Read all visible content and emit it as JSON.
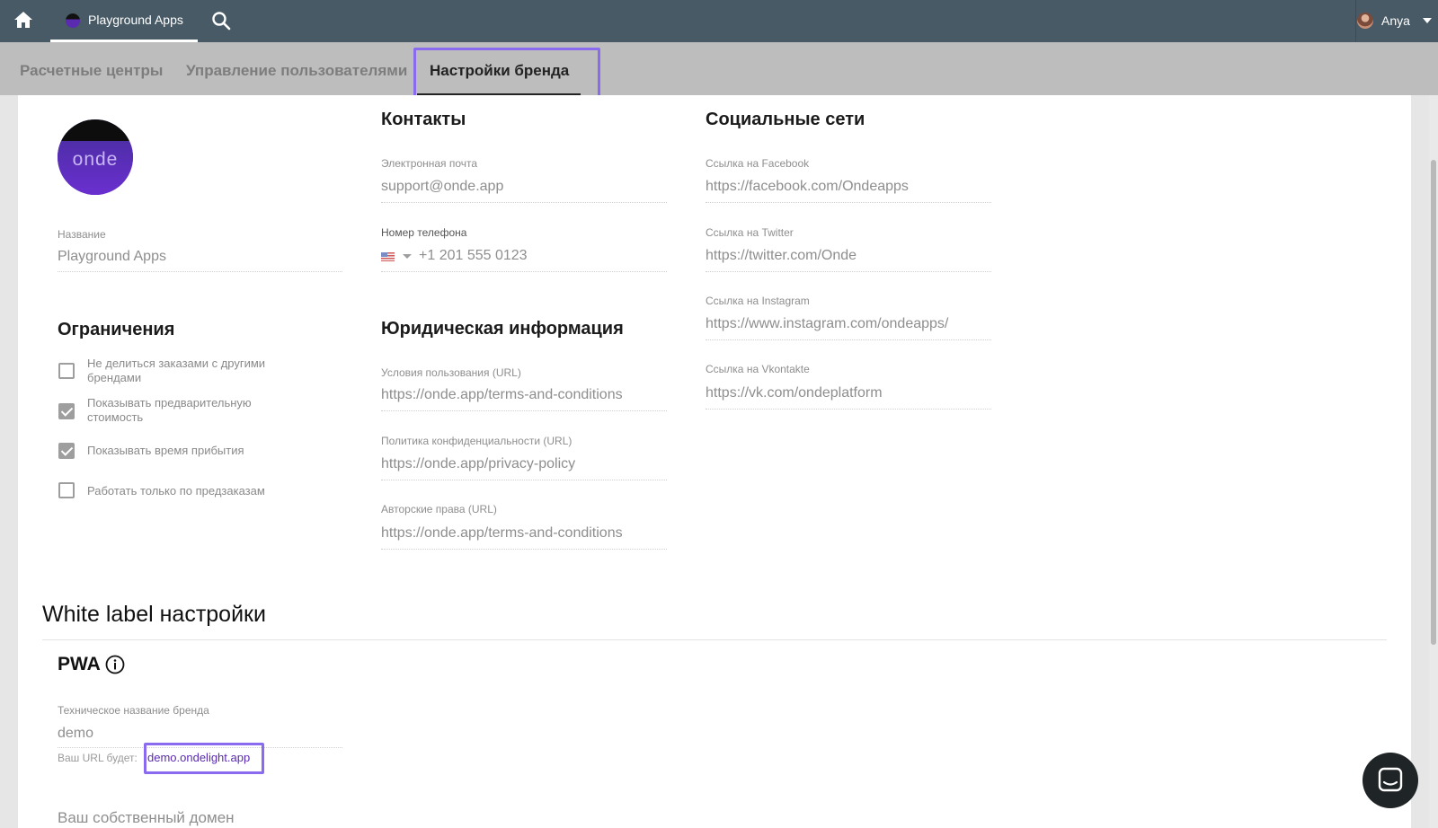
{
  "topbar": {
    "app_tab_label": "Playground Apps",
    "user_name": "Anya",
    "icons": [
      "home-icon",
      "search-icon",
      "caret-down-icon"
    ]
  },
  "subtabs": [
    {
      "label": "Расчетные центры",
      "active": false
    },
    {
      "label": "Управление пользователями",
      "active": false
    },
    {
      "label": "Настройки бренда",
      "active": true
    }
  ],
  "brand": {
    "logo_text": "onde",
    "name_label": "Название",
    "name_value": "Playground Apps"
  },
  "restrictions": {
    "title": "Ограничения",
    "items": [
      {
        "label": "Не делиться заказами с другими брендами",
        "checked": false
      },
      {
        "label": "Показывать предварительную стоимость",
        "checked": true
      },
      {
        "label": "Показывать время прибытия",
        "checked": true
      },
      {
        "label": "Работать только по предзаказам",
        "checked": false
      }
    ]
  },
  "contacts": {
    "title": "Контакты",
    "email_label": "Электронная почта",
    "email_value": "support@onde.app",
    "phone_label": "Номер телефона",
    "phone_value": "+1 201 555 0123"
  },
  "legal": {
    "title": "Юридическая информация",
    "terms_label": "Условия пользования (URL)",
    "terms_value": "https://onde.app/terms-and-conditions",
    "privacy_label": "Политика конфиденциальности (URL)",
    "privacy_value": "https://onde.app/privacy-policy",
    "copyright_label": "Авторские права (URL)",
    "copyright_value": "https://onde.app/terms-and-conditions"
  },
  "social": {
    "title": "Социальные сети",
    "facebook_label": "Ссылка на Facebook",
    "facebook_value": "https://facebook.com/Ondeapps",
    "twitter_label": "Ссылка на Twitter",
    "twitter_value": "https://twitter.com/Onde",
    "instagram_label": "Ссылка на Instagram",
    "instagram_value": "https://www.instagram.com/ondeapps/",
    "vk_label": "Ссылка на Vkontakte",
    "vk_value": "https://vk.com/ondeplatform"
  },
  "white_label": {
    "title": "White label настройки",
    "pwa_title": "PWA",
    "tech_name_label": "Техническое название бренда",
    "tech_name_value": "demo",
    "url_hint": "Ваш URL будет:",
    "url_value": "demo.ondelight.app",
    "own_domain_label": "Ваш собственный домен"
  },
  "colors": {
    "topbar": "#475a66",
    "accent": "#5a2bb0",
    "highlight": "#8a6bf0"
  }
}
